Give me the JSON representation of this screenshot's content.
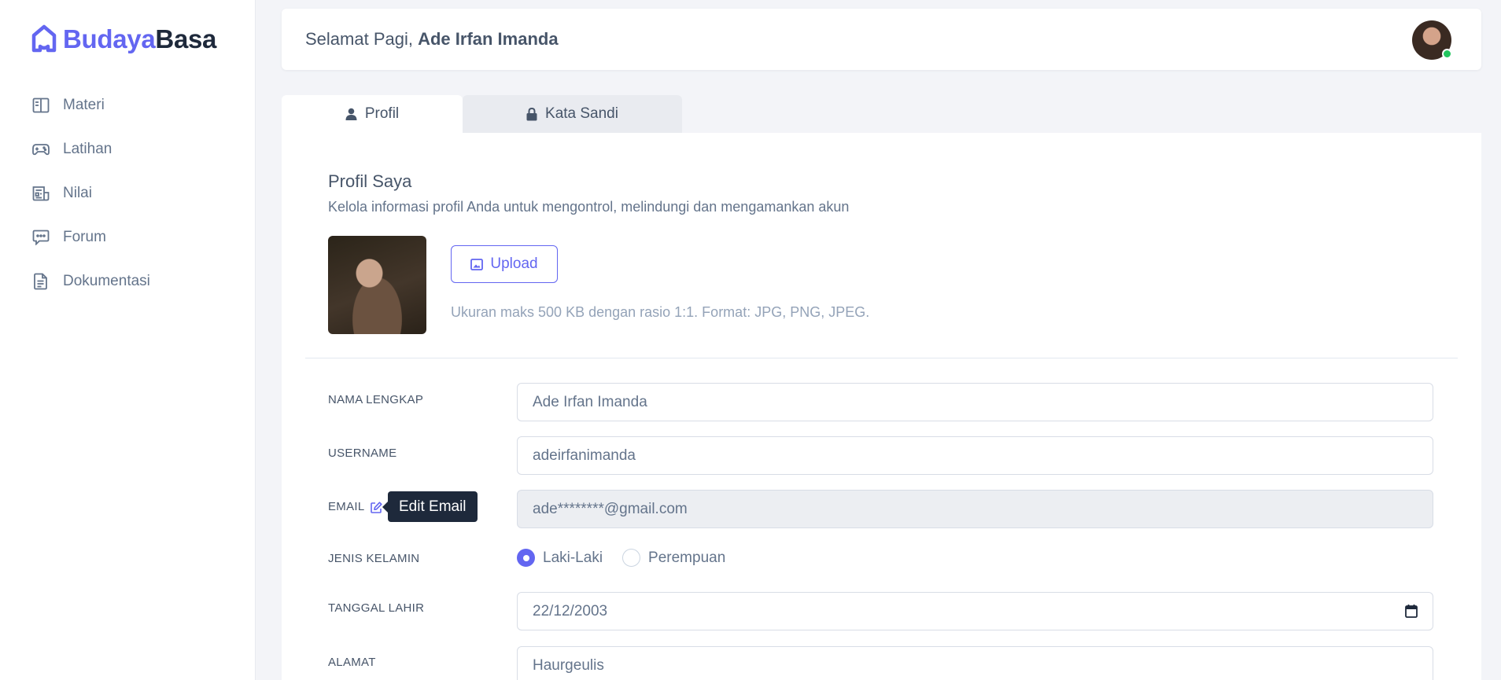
{
  "brand": {
    "name_part1": "Budaya",
    "name_part2": "Basa",
    "color_primary": "#6366f1",
    "color_dark": "#1e293b"
  },
  "sidebar": {
    "items": [
      {
        "label": "Materi",
        "icon": "book-open-icon"
      },
      {
        "label": "Latihan",
        "icon": "gamepad-icon"
      },
      {
        "label": "Nilai",
        "icon": "report-icon"
      },
      {
        "label": "Forum",
        "icon": "chat-icon"
      },
      {
        "label": "Dokumentasi",
        "icon": "document-icon"
      }
    ]
  },
  "header": {
    "greeting": "Selamat Pagi,",
    "user_name": "Ade Irfan Imanda",
    "status": "online",
    "status_color": "#22c55e"
  },
  "tabs": [
    {
      "label": "Profil",
      "icon": "user-icon",
      "active": true
    },
    {
      "label": "Kata Sandi",
      "icon": "lock-icon",
      "active": false
    }
  ],
  "profile": {
    "title": "Profil Saya",
    "subtitle": "Kelola informasi profil Anda untuk mengontrol, melindungi dan mengamankan akun",
    "upload_label": "Upload",
    "upload_hint": "Ukuran maks 500 KB dengan rasio 1:1. Format: JPG, PNG, JPEG."
  },
  "form": {
    "full_name": {
      "label": "NAMA LENGKAP",
      "value": "Ade Irfan Imanda"
    },
    "username": {
      "label": "USERNAME",
      "value": "adeirfanimanda"
    },
    "email": {
      "label": "EMAIL",
      "value": "ade********@gmail.com",
      "tooltip": "Edit Email",
      "disabled": true
    },
    "gender": {
      "label": "JENIS KELAMIN",
      "options": [
        "Laki-Laki",
        "Perempuan"
      ],
      "selected": "Laki-Laki"
    },
    "birth_date": {
      "label": "TANGGAL LAHIR",
      "value": "22/12/2003"
    },
    "address": {
      "label": "ALAMAT",
      "value": "Haurgeulis"
    }
  }
}
